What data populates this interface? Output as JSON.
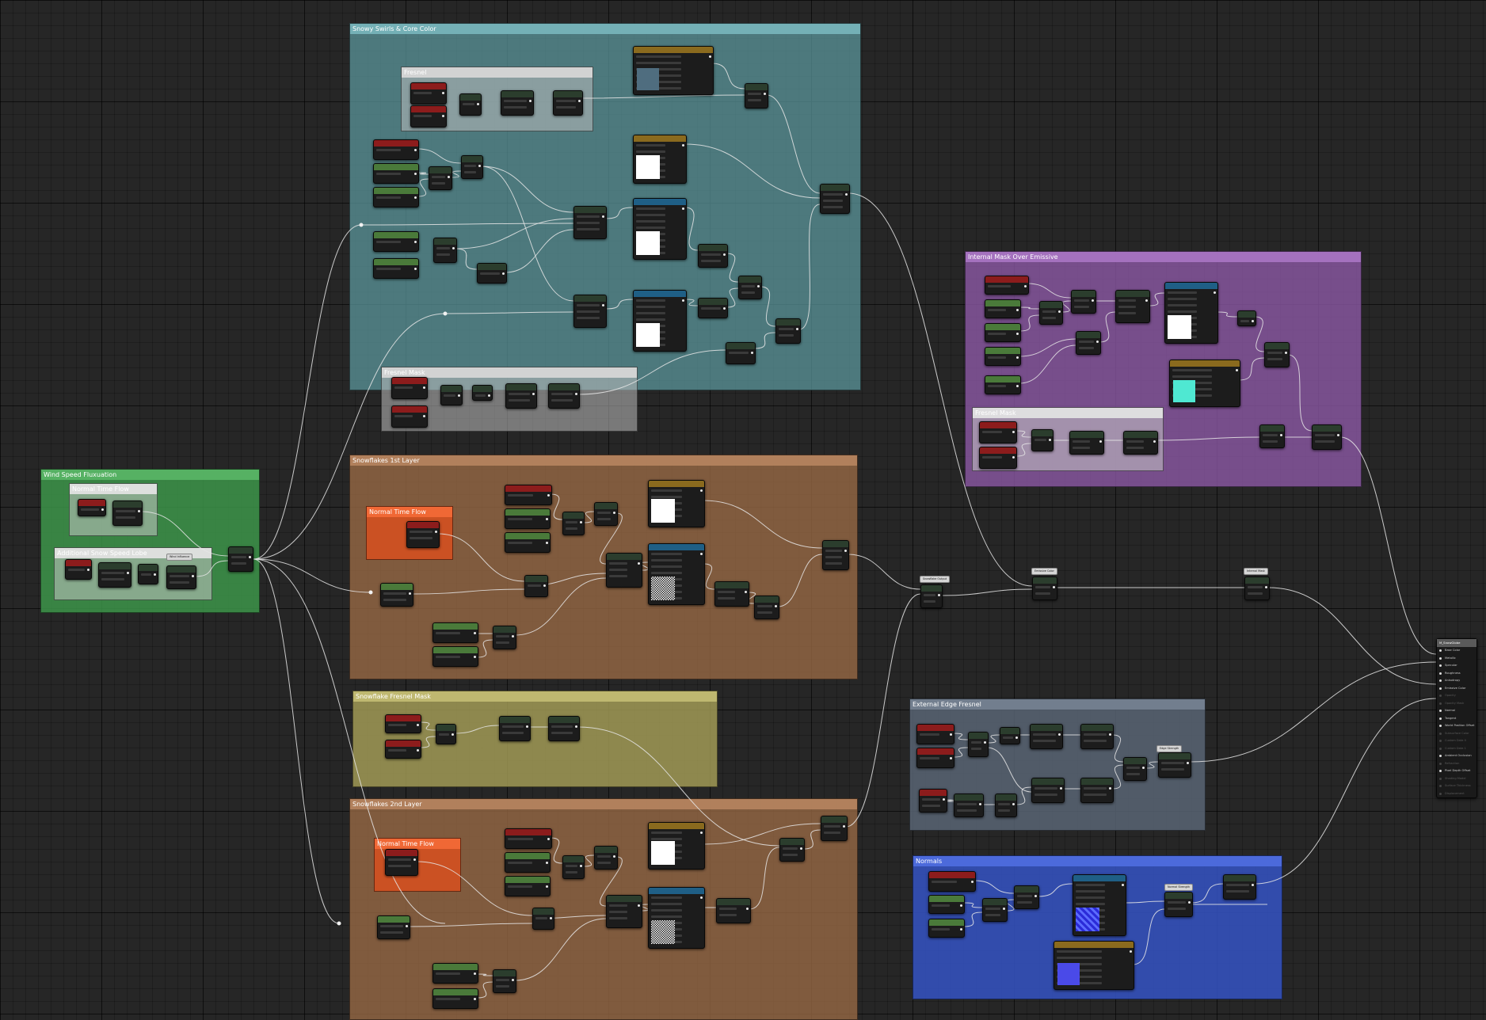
{
  "comment_groups": [
    {
      "key": "snowy_swirls",
      "title": "Snowy Swirls & Core Color",
      "color": "#5d9aa0",
      "alpha": 0.72
    },
    {
      "key": "fresnel_a",
      "title": "Fresnel",
      "color": "#bdbdbd",
      "alpha": 0.55
    },
    {
      "key": "fresnel_mask_a",
      "title": "Fresnel Mask",
      "color": "#bdbdbd",
      "alpha": 0.55
    },
    {
      "key": "wind_speed",
      "title": "Wind Speed Fluxuation",
      "color": "#3e9a4c",
      "alpha": 0.82
    },
    {
      "key": "normal_time_flow_a",
      "title": "Normal Time Flow",
      "color": "#c9c9c9",
      "alpha": 0.55
    },
    {
      "key": "additional_snow",
      "title": "Additional Snow Speed Lobe",
      "color": "#c9c9c9",
      "alpha": 0.55
    },
    {
      "key": "snowflakes_1",
      "title": "Snowflakes 1st Layer",
      "color": "#9a6a45",
      "alpha": 0.78
    },
    {
      "key": "normal_time_flow_b",
      "title": "Normal Time Flow",
      "color": "#d8501e",
      "alpha": 0.85
    },
    {
      "key": "snowflake_fresnel",
      "title": "Snowflake Fresnel Mask",
      "color": "#a9a159",
      "alpha": 0.8
    },
    {
      "key": "snowflakes_2",
      "title": "Snowflakes 2nd Layer",
      "color": "#9a6a45",
      "alpha": 0.78
    },
    {
      "key": "normal_time_flow_c",
      "title": "Normal Time Flow",
      "color": "#d8501e",
      "alpha": 0.85
    },
    {
      "key": "internal_mask",
      "title": "Internal Mask Over Emissive",
      "color": "#8e5aa8",
      "alpha": 0.78
    },
    {
      "key": "fresnel_mask_b",
      "title": "Fresnel Mask",
      "color": "#c9c9c9",
      "alpha": 0.55
    },
    {
      "key": "external_edge",
      "title": "External Edge Fresnel",
      "color": "#5b6877",
      "alpha": 0.82
    },
    {
      "key": "normals",
      "title": "Normals",
      "color": "#3553c4",
      "alpha": 0.85
    }
  ],
  "reroute_labels": {
    "emissive_color": "Emissive Color",
    "snowflake_output": "Snowflake Output",
    "internal_mask": "Internal Mask",
    "normal_strength": "Normal Strength",
    "wind_influence": "Wind Influence",
    "edge_strength": "Edge Strength"
  },
  "result_node": {
    "title": "M_SnowGlobe",
    "pins": [
      {
        "label": "Base Color",
        "active": true
      },
      {
        "label": "Metallic",
        "active": true
      },
      {
        "label": "Specular",
        "active": true
      },
      {
        "label": "Roughness",
        "active": true
      },
      {
        "label": "Anisotropy",
        "active": true
      },
      {
        "label": "Emissive Color",
        "active": true
      },
      {
        "label": "Opacity",
        "active": false
      },
      {
        "label": "Opacity Mask",
        "active": false
      },
      {
        "label": "Normal",
        "active": true
      },
      {
        "label": "Tangent",
        "active": true
      },
      {
        "label": "World Position Offset",
        "active": true
      },
      {
        "label": "Subsurface Color",
        "active": false
      },
      {
        "label": "Custom Data 0",
        "active": false
      },
      {
        "label": "Custom Data 1",
        "active": false
      },
      {
        "label": "Ambient Occlusion",
        "active": true
      },
      {
        "label": "Refraction",
        "active": false
      },
      {
        "label": "Pixel Depth Offset",
        "active": true
      },
      {
        "label": "Shading Model",
        "active": false
      },
      {
        "label": "Surface Thickness",
        "active": false
      },
      {
        "label": "Displacement",
        "active": false
      }
    ]
  },
  "colors": {
    "wire": "#e6e6e6",
    "node_param_green": "#4a7a3a",
    "node_red": "#8c1c1c",
    "node_texture_blue": "#1f5f86",
    "node_constant_gold": "#8a6a1e",
    "node_math_dark": "#2b3d2d",
    "swatch_steel": "#4f6d7f",
    "swatch_white": "#ffffff",
    "swatch_cyan": "#4fe8d2",
    "swatch_blue": "#4a4ae8"
  }
}
